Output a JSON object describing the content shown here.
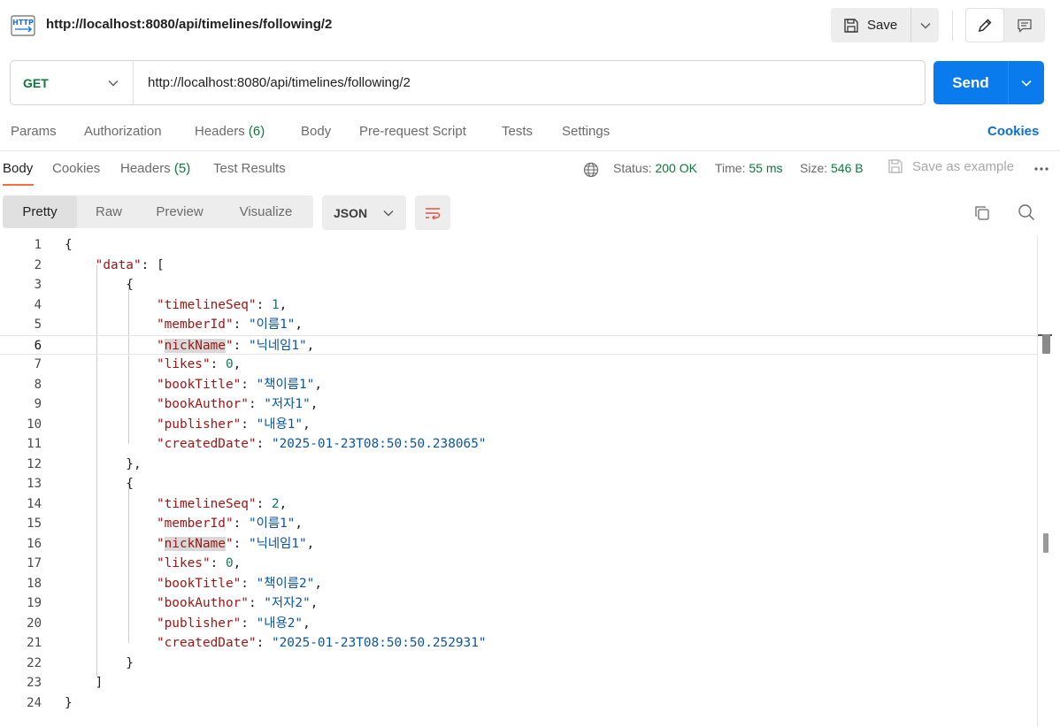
{
  "header": {
    "icon": "http-request-icon",
    "icon_label": "HTTP",
    "title": "http://localhost:8080/api/timelines/following/2",
    "save_label": "Save"
  },
  "request": {
    "method": "GET",
    "url": "http://localhost:8080/api/timelines/following/2",
    "send_label": "Send",
    "method_color": "#0b7a3b",
    "send_color": "#097bed"
  },
  "request_tabs": {
    "params": "Params",
    "authorization": "Authorization",
    "headers": "Headers",
    "headers_count": "(6)",
    "body": "Body",
    "pre_request": "Pre-request Script",
    "tests": "Tests",
    "settings": "Settings",
    "cookies": "Cookies"
  },
  "response_tabs": {
    "body": "Body",
    "cookies": "Cookies",
    "headers": "Headers",
    "headers_count": "(5)",
    "test_results": "Test Results",
    "active_color": "#ff6c37"
  },
  "status": {
    "status_label": "Status:",
    "status_value": "200 OK",
    "time_label": "Time:",
    "time_value": "55 ms",
    "size_label": "Size:",
    "size_value": "546 B",
    "save_example": "Save as example"
  },
  "format": {
    "pretty": "Pretty",
    "raw": "Raw",
    "preview": "Preview",
    "visualize": "Visualize",
    "language": "JSON"
  },
  "code_lines": [
    {
      "n": "1",
      "html": "{"
    },
    {
      "n": "2",
      "html": "    <span class=\"k\">\"data\"</span>: ["
    },
    {
      "n": "3",
      "html": "        {"
    },
    {
      "n": "4",
      "html": "            <span class=\"k\">\"timelineSeq\"</span>: <span class=\"n\">1</span>,"
    },
    {
      "n": "5",
      "html": "            <span class=\"k\">\"memberId\"</span>: <span class=\"s\">\"이름1\"</span>,"
    },
    {
      "n": "6",
      "html": "            <span class=\"k\">\"<span class=\"hl\">nickName</span>\"</span>: <span class=\"s\">\"닉네임1\"</span>,",
      "current": true
    },
    {
      "n": "7",
      "html": "            <span class=\"k\">\"likes\"</span>: <span class=\"n\">0</span>,"
    },
    {
      "n": "8",
      "html": "            <span class=\"k\">\"bookTitle\"</span>: <span class=\"s\">\"책이름1\"</span>,"
    },
    {
      "n": "9",
      "html": "            <span class=\"k\">\"bookAuthor\"</span>: <span class=\"s\">\"저자1\"</span>,"
    },
    {
      "n": "10",
      "html": "            <span class=\"k\">\"publisher\"</span>: <span class=\"s\">\"내용1\"</span>,"
    },
    {
      "n": "11",
      "html": "            <span class=\"k\">\"createdDate\"</span>: <span class=\"s\">\"2025-01-23T08:50:50.238065\"</span>"
    },
    {
      "n": "12",
      "html": "        },"
    },
    {
      "n": "13",
      "html": "        {"
    },
    {
      "n": "14",
      "html": "            <span class=\"k\">\"timelineSeq\"</span>: <span class=\"n\">2</span>,"
    },
    {
      "n": "15",
      "html": "            <span class=\"k\">\"memberId\"</span>: <span class=\"s\">\"이름1\"</span>,"
    },
    {
      "n": "16",
      "html": "            <span class=\"k\">\"<span class=\"hl\">nickName</span>\"</span>: <span class=\"s\">\"닉네임1\"</span>,"
    },
    {
      "n": "17",
      "html": "            <span class=\"k\">\"likes\"</span>: <span class=\"n\">0</span>,"
    },
    {
      "n": "18",
      "html": "            <span class=\"k\">\"bookTitle\"</span>: <span class=\"s\">\"책이름2\"</span>,"
    },
    {
      "n": "19",
      "html": "            <span class=\"k\">\"bookAuthor\"</span>: <span class=\"s\">\"저자2\"</span>,"
    },
    {
      "n": "20",
      "html": "            <span class=\"k\">\"publisher\"</span>: <span class=\"s\">\"내용2\"</span>,"
    },
    {
      "n": "21",
      "html": "            <span class=\"k\">\"createdDate\"</span>: <span class=\"s\">\"2025-01-23T08:50:50.252931\"</span>"
    },
    {
      "n": "22",
      "html": "        }"
    },
    {
      "n": "23",
      "html": "    ]"
    },
    {
      "n": "24",
      "html": "}"
    }
  ]
}
